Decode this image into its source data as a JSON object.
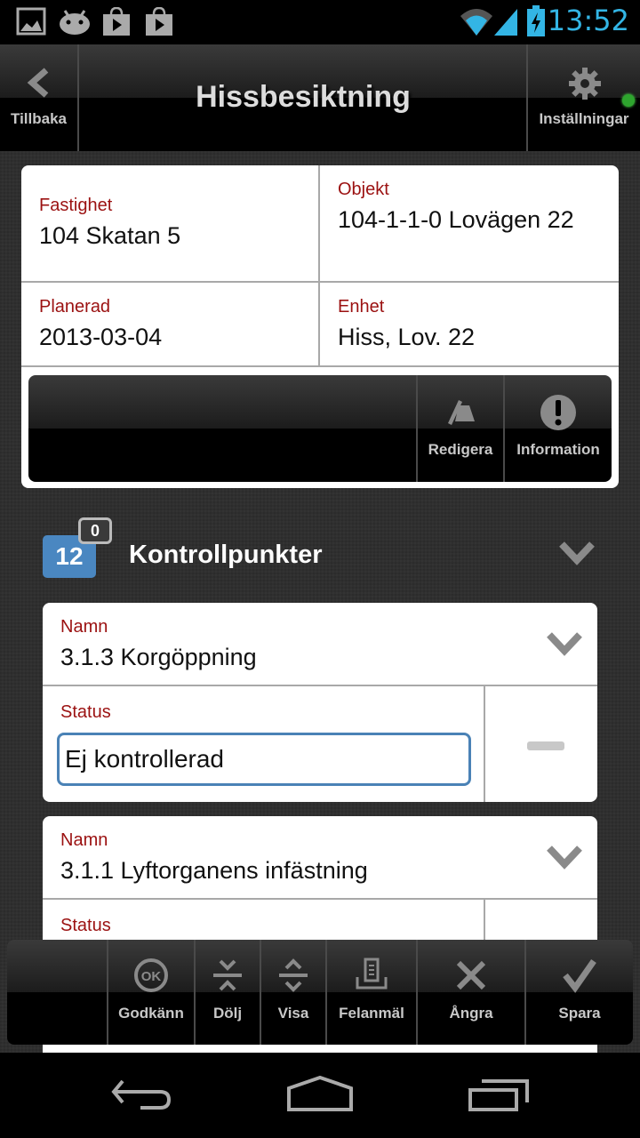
{
  "status_bar": {
    "time": "13:52",
    "notification_icons": [
      "gallery-icon",
      "android-icon",
      "play-store-icon",
      "play-store-icon"
    ],
    "system_icons": [
      "wifi-icon",
      "signal-icon",
      "battery-charging-icon"
    ],
    "colors": {
      "accent": "#33b5e5"
    }
  },
  "action_bar": {
    "back_label": "Tillbaka",
    "title": "Hissbesiktning",
    "settings_label": "Inställningar",
    "sync_indicator_color": "#2ea52e"
  },
  "info": {
    "fastighet": {
      "label": "Fastighet",
      "value": "104 Skatan 5"
    },
    "objekt": {
      "label": "Objekt",
      "value": "104-1-1-0 Lovägen 22"
    },
    "planerad": {
      "label": "Planerad",
      "value": "2013-03-04"
    },
    "enhet": {
      "label": "Enhet",
      "value": "Hiss, Lov. 22"
    },
    "toolbar": {
      "edit_label": "Redigera",
      "info_label": "Information"
    }
  },
  "section": {
    "count": "12",
    "sub_count": "0",
    "title": "Kontrollpunkter",
    "badge_color": "#4a87c1"
  },
  "checkpoints": [
    {
      "name_label": "Namn",
      "name": "3.1.3 Korgöppning",
      "status_label": "Status",
      "status": "Ej kontrollerad"
    },
    {
      "name_label": "Namn",
      "name": "3.1.1 Lyftorganens infästning",
      "status_label": "Status"
    }
  ],
  "bottom_toolbar": {
    "approve_label": "Godkänn",
    "hide_label": "Dölj",
    "show_label": "Visa",
    "report_label": "Felanmäl",
    "undo_label": "Ångra",
    "save_label": "Spara"
  },
  "colors": {
    "field_label": "#9b1111",
    "input_focus": "#4a82b6"
  }
}
